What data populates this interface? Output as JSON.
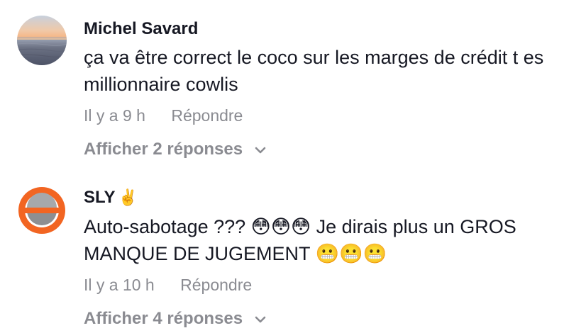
{
  "comments": [
    {
      "username": "Michel Savard",
      "badge": "",
      "text": "ça va être correct le coco sur les marges de crédit t es millionnaire cowlis",
      "time": "Il y a 9 h",
      "reply_label": "Répondre",
      "view_replies_label": "Afficher 2 réponses"
    },
    {
      "username": "SLY",
      "badge": "✌️",
      "text": "Auto-sabotage ??? 😳😳😳 Je dirais plus un GROS MANQUE DE JUGEMENT 😬😬😬",
      "time": "Il y a 10 h",
      "reply_label": "Répondre",
      "view_replies_label": "Afficher 4 réponses"
    }
  ],
  "icons": {
    "expand": "chevron-down-icon"
  },
  "colors": {
    "primary_text": "#161823",
    "secondary_text": "#8a8b91",
    "avatar_orange": "#f26522",
    "avatar_gray": "#8d8f92"
  }
}
